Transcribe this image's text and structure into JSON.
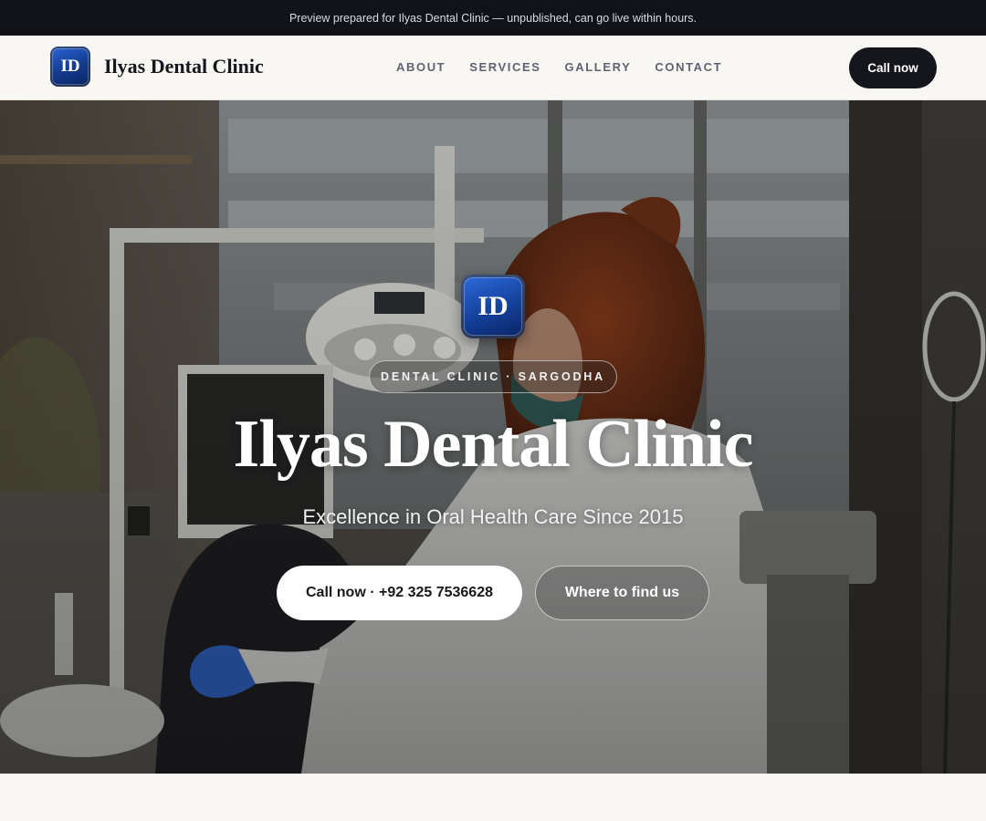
{
  "preview_banner": "Preview prepared for Ilyas Dental Clinic — unpublished, can go live within hours.",
  "header": {
    "logo_text": "ID",
    "brand_name": "Ilyas Dental Clinic",
    "nav": [
      "ABOUT",
      "SERVICES",
      "GALLERY",
      "CONTACT"
    ],
    "cta_label": "Call now"
  },
  "hero": {
    "logo_text": "ID",
    "badge": "DENTAL CLINIC · SARGODHA",
    "title": "Ilyas Dental Clinic",
    "subtitle": "Excellence in Oral Health Care Since 2015",
    "primary_button": "Call now · +92 325 7536628",
    "secondary_button": "Where to find us"
  },
  "colors": {
    "brand_blue": "#1a4fb8",
    "dark": "#15161b",
    "page_background": "#f8f7f4"
  },
  "icons": {
    "logo": "id-monogram-logo"
  }
}
